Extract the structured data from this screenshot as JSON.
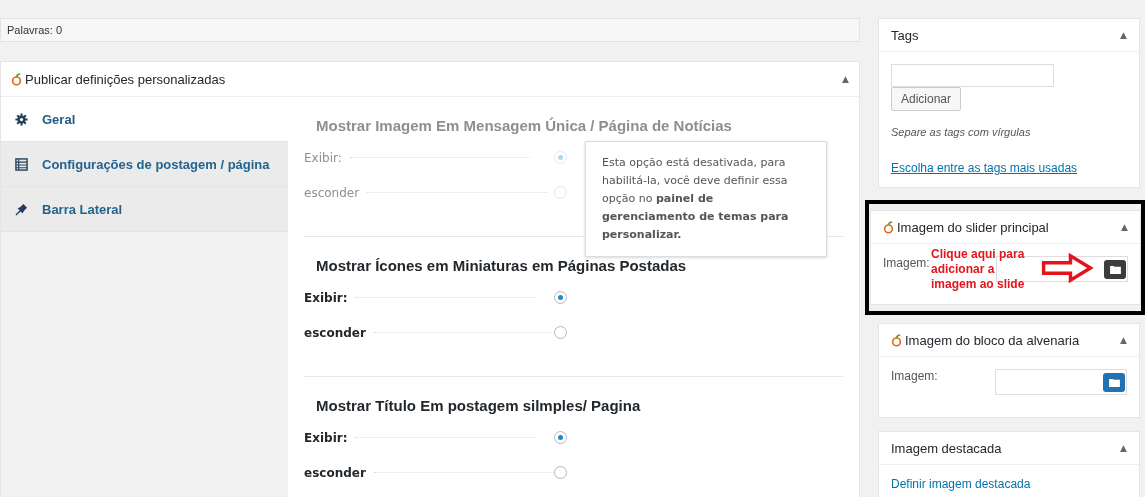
{
  "word_count": "Palavras: 0",
  "custom_settings": {
    "title": "Publicar definições personalizadas",
    "toggle": "▲",
    "tabs": [
      {
        "label": "Geral",
        "selected": true
      },
      {
        "label": "Configurações de postagem / página",
        "selected": false
      },
      {
        "label": "Barra Lateral",
        "selected": false
      }
    ],
    "sections": [
      {
        "title": "Mostrar Imagem Em Mensagem Única / Página de Notícias",
        "disabled": true,
        "options": [
          {
            "label": "Exibir:",
            "selected": true
          },
          {
            "label": "esconder",
            "selected": false
          }
        ],
        "tooltip": "Esta opção está desativada, para habilitá-la, você deve definir essa opção no **painel de gerenciamento de temas para personalizar.**"
      },
      {
        "title": "Mostrar Ícones em Miniaturas em Páginas Postadas",
        "disabled": false,
        "options": [
          {
            "label": "Exibir:",
            "selected": true
          },
          {
            "label": "esconder",
            "selected": false
          }
        ]
      },
      {
        "title": "Mostrar Título Em postagem silmples/ Pagina",
        "disabled": false,
        "options": [
          {
            "label": "Exibir:",
            "selected": true
          },
          {
            "label": "esconder",
            "selected": false
          }
        ]
      }
    ]
  },
  "widgets": [
    {
      "kind": "tags",
      "title": "Tags",
      "toggle": "▲",
      "button": "Adicionar",
      "hint": "Separe as tags com vírgulas",
      "link": "Escolha entre as tags mais usadas",
      "highlighted": false
    },
    {
      "kind": "image",
      "title": "Imagem do slider principal",
      "toggle": "▲",
      "field_label": "Imagem:",
      "dark_button": true,
      "highlighted": true,
      "annotation": "Clique aqui para adicionar a imagem ao slide"
    },
    {
      "kind": "image",
      "title": "Imagem do bloco da alvenaria",
      "toggle": "▲",
      "field_label": "Imagem:",
      "dark_button": false,
      "highlighted": false
    },
    {
      "kind": "link",
      "title": "Imagem destacada",
      "toggle": "▲",
      "link": "Definir imagem destacada",
      "highlighted": false
    }
  ]
}
